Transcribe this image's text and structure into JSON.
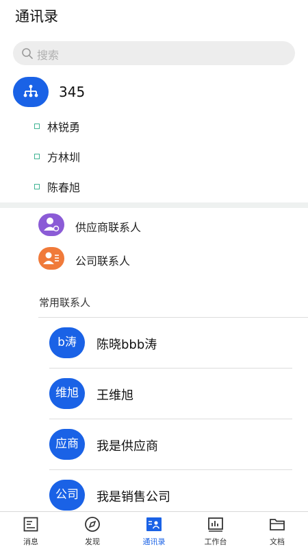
{
  "header": {
    "title": "通讯录"
  },
  "search": {
    "placeholder": "搜索"
  },
  "org": {
    "name": "345",
    "members": [
      "林锐勇",
      "方林圳",
      "陈春旭"
    ]
  },
  "entries": [
    {
      "label": "供应商联系人",
      "color": "#8b5bd6"
    },
    {
      "label": "公司联系人",
      "color": "#f07a3a"
    }
  ],
  "frequent": {
    "title": "常用联系人",
    "contacts": [
      {
        "avatar_text": "b涛",
        "name": "陈晓bbb涛"
      },
      {
        "avatar_text": "维旭",
        "name": "王维旭"
      },
      {
        "avatar_text": "应商",
        "name": "我是供应商"
      },
      {
        "avatar_text": "公司",
        "name": "我是销售公司"
      }
    ]
  },
  "tabs": [
    {
      "label": "消息",
      "icon": "message-icon"
    },
    {
      "label": "发现",
      "icon": "compass-icon"
    },
    {
      "label": "通讯录",
      "icon": "contacts-icon",
      "active": true
    },
    {
      "label": "工作台",
      "icon": "chart-icon"
    },
    {
      "label": "文档",
      "icon": "folder-icon"
    }
  ],
  "colors": {
    "accent": "#1a62e6",
    "member_dot": "#3fb392"
  }
}
